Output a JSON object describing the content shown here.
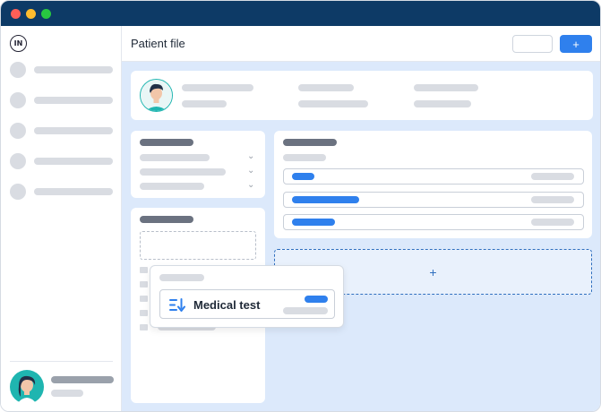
{
  "window": {
    "controls": [
      "close",
      "minimize",
      "maximize"
    ]
  },
  "sidebar": {
    "logo_text": "IN",
    "nav_items": [
      {
        "icon": "placeholder-circle"
      },
      {
        "icon": "placeholder-circle"
      },
      {
        "icon": "placeholder-circle"
      },
      {
        "icon": "placeholder-circle"
      },
      {
        "icon": "placeholder-circle"
      }
    ],
    "user": {
      "avatar": "user-avatar-icon"
    }
  },
  "header": {
    "title": "Patient file",
    "add_button_label": "+"
  },
  "main": {
    "drop_zone_label": "+",
    "dragged_item": {
      "label": "Medical test",
      "icon": "sort-descending-icon"
    }
  },
  "colors": {
    "titlebar": "#0d3a66",
    "accent": "#2f80ed",
    "main_background": "#dce9fb",
    "placeholder": "#d9dce2"
  }
}
